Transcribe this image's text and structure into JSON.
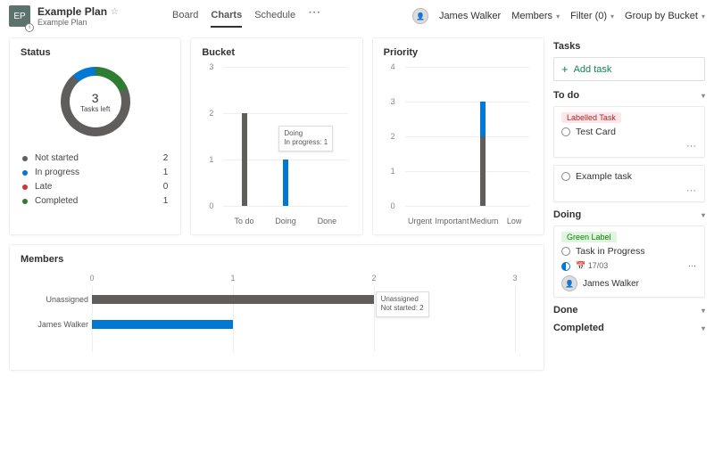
{
  "plan": {
    "initials": "EP",
    "title": "Example Plan",
    "subtitle": "Example Plan"
  },
  "nav": {
    "board": "Board",
    "charts": "Charts",
    "schedule": "Schedule"
  },
  "user": {
    "name": "James Walker"
  },
  "toolbar": {
    "members": "Members",
    "filter": "Filter (0)",
    "group": "Group by Bucket"
  },
  "status": {
    "title": "Status",
    "center_num": "3",
    "center_lbl": "Tasks left",
    "legend": [
      {
        "label": "Not started",
        "value": "2",
        "color": "#605e5c"
      },
      {
        "label": "In progress",
        "value": "1",
        "color": "#0078d4"
      },
      {
        "label": "Late",
        "value": "0",
        "color": "#d13438"
      },
      {
        "label": "Completed",
        "value": "1",
        "color": "#2e7d32"
      }
    ]
  },
  "bucket": {
    "title": "Bucket",
    "ymax": 3,
    "bars": [
      {
        "label": "To do",
        "value": 2,
        "color": "#605e5c"
      },
      {
        "label": "Doing",
        "value": 1,
        "color": "#0078d4"
      },
      {
        "label": "Done",
        "value": 0,
        "color": "#605e5c"
      }
    ],
    "tooltip": {
      "line1": "Doing",
      "line2": "In progress: 1"
    }
  },
  "priority": {
    "title": "Priority",
    "ymax": 4,
    "bars": [
      {
        "label": "Urgent",
        "value": 0,
        "color": "#605e5c"
      },
      {
        "label": "Important",
        "value": 0,
        "color": "#605e5c"
      },
      {
        "label": "Medium",
        "stack": [
          {
            "value": 2,
            "color": "#605e5c"
          },
          {
            "value": 1,
            "color": "#0078d4"
          }
        ]
      },
      {
        "label": "Low",
        "value": 0,
        "color": "#605e5c"
      }
    ]
  },
  "members": {
    "title": "Members",
    "xmax": 3,
    "rows": [
      {
        "label": "Unassigned",
        "segments": [
          {
            "value": 2,
            "color": "#605e5c"
          }
        ]
      },
      {
        "label": "James Walker",
        "segments": [
          {
            "value": 1,
            "color": "#0078d4"
          }
        ]
      }
    ],
    "tooltip": {
      "line1": "Unassigned",
      "line2": "Not started: 2"
    }
  },
  "tasks": {
    "heading": "Tasks",
    "add": "Add task",
    "sections": {
      "todo": "To do",
      "doing": "Doing",
      "done": "Done",
      "completed": "Completed"
    },
    "todo_items": [
      {
        "pill": "Labelled Task",
        "pill_bg": "#fde7e9",
        "pill_fg": "#a4262c",
        "title": "Test Card"
      },
      {
        "title": "Example task"
      }
    ],
    "doing_items": [
      {
        "pill": "Green Label",
        "pill_bg": "#dff6dd",
        "pill_fg": "#107c10",
        "title": "Task in Progress",
        "date": "17/03",
        "assignee": "James Walker"
      }
    ]
  },
  "chart_data": [
    {
      "type": "pie",
      "title": "Status",
      "categories": [
        "Not started",
        "In progress",
        "Late",
        "Completed"
      ],
      "values": [
        2,
        1,
        0,
        1
      ],
      "center_label": "3 Tasks left"
    },
    {
      "type": "bar",
      "title": "Bucket",
      "categories": [
        "To do",
        "Doing",
        "Done"
      ],
      "values": [
        2,
        1,
        0
      ],
      "ylim": [
        0,
        3
      ]
    },
    {
      "type": "bar",
      "title": "Priority",
      "categories": [
        "Urgent",
        "Important",
        "Medium",
        "Low"
      ],
      "series": [
        {
          "name": "Not started",
          "values": [
            0,
            0,
            2,
            0
          ]
        },
        {
          "name": "In progress",
          "values": [
            0,
            0,
            1,
            0
          ]
        }
      ],
      "ylim": [
        0,
        4
      ]
    },
    {
      "type": "bar",
      "title": "Members",
      "orientation": "horizontal",
      "categories": [
        "Unassigned",
        "James Walker"
      ],
      "series": [
        {
          "name": "Not started",
          "values": [
            2,
            0
          ]
        },
        {
          "name": "In progress",
          "values": [
            0,
            1
          ]
        }
      ],
      "xlim": [
        0,
        3
      ]
    }
  ]
}
